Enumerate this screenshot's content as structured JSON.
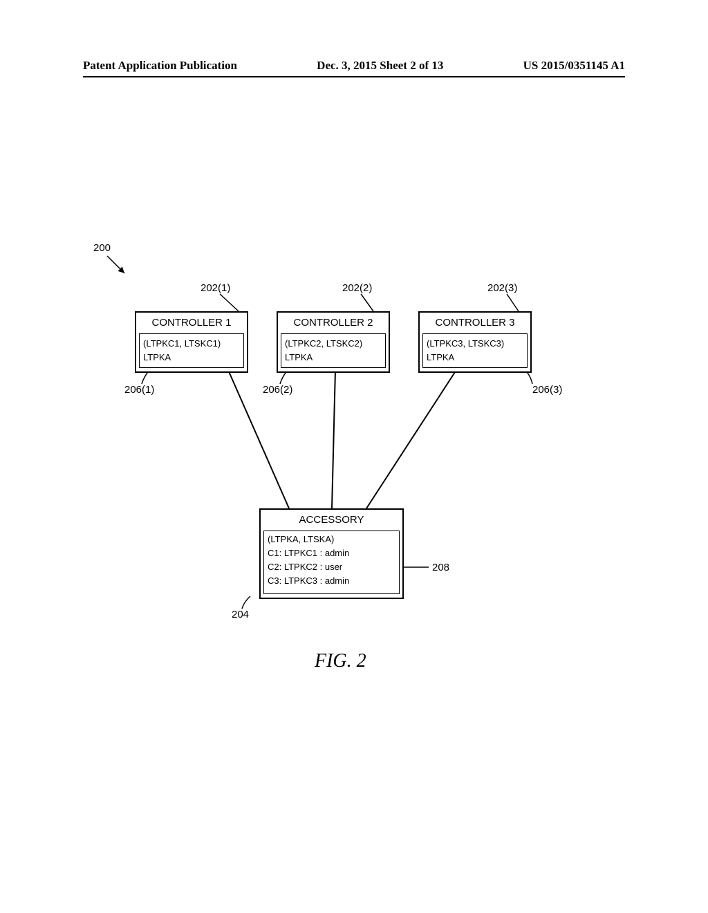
{
  "header": {
    "left": "Patent Application Publication",
    "center": "Dec. 3, 2015   Sheet 2 of 13",
    "right": "US 2015/0351145 A1"
  },
  "refs": {
    "system": "200",
    "c1": "202(1)",
    "c2": "202(2)",
    "c3": "202(3)",
    "c1box": "206(1)",
    "c2box": "206(2)",
    "c3box": "206(3)",
    "acc": "204",
    "accbox": "208"
  },
  "controllers": [
    {
      "title": "CONTROLLER 1",
      "line1": "(LTPKC1, LTSKC1)",
      "line2": "LTPKA"
    },
    {
      "title": "CONTROLLER 2",
      "line1": "(LTPKC2, LTSKC2)",
      "line2": "LTPKA"
    },
    {
      "title": "CONTROLLER 3",
      "line1": "(LTPKC3, LTSKC3)",
      "line2": "LTPKA"
    }
  ],
  "accessory": {
    "title": "ACCESSORY",
    "line1": "(LTPKA, LTSKA)",
    "line2": "C1: LTPKC1 : admin",
    "line3": "C2: LTPKC2 : user",
    "line4": "C3: LTPKC3 : admin"
  },
  "caption": "FIG. 2"
}
